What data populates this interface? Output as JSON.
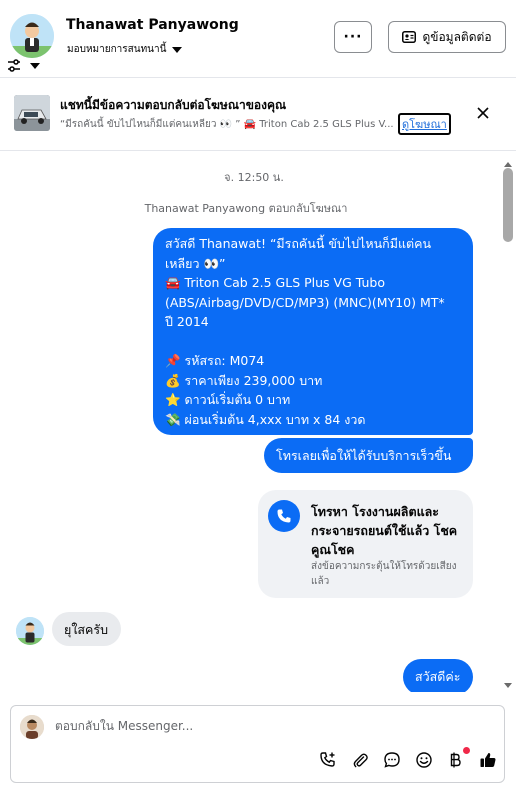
{
  "header": {
    "contact_name": "Thanawat Panyawong",
    "assign_label": "มอบหมายการสนทนานี้",
    "more_label": "···",
    "contact_info_label": "ดูข้อมูลติดต่อ"
  },
  "ad_banner": {
    "title": "แชทนี้มีข้อความตอบกลับต่อโฆษณาของคุณ",
    "subtitle": "“มีรถคันนี้ ขับไปไหนก็มีแต่คนเหลียว 👀 ” 🚘 Triton Cab 2.5 GLS Plus V...",
    "link_label": "ดูโฆษณา"
  },
  "chat": {
    "timestamp": "จ. 12:50 น.",
    "reply_note": "Thanawat Panyawong ตอบกลับโฆษณา",
    "messages": {
      "ad_message": {
        "line1": "สวัสดี Thanawat! “มีรถคันนี้ ขับไปไหนก็มีแต่คน",
        "line2": "เหลียว 👀”",
        "line3": "🚘 Triton Cab 2.5 GLS Plus VG Tubo",
        "line4": "(ABS/Airbag/DVD/CD/MP3) (MNC)(MY10) MT*",
        "line5": "ปี 2014",
        "line6": "📌 รหัสรถ: M074",
        "line7": "💰 ราคาเพียง 239,000 บาท",
        "line8": "⭐ ดาวน์เริ่มต้น 0 บาท",
        "line9": "💸 ผ่อนเริ่มต้น 4,xxx บาท x 84 งวด"
      },
      "call_prompt": "โทรเลยเพื่อให้ได้รับบริการเร็วขึ้น",
      "call_card": {
        "title": "โทรหา โรงงานผลิตและกระจายรถยนต์ใช้แล้ว โชคคูณโชค",
        "subtitle": "ส่งข้อความกระตุ้นให้โทรด้วยเสียงแล้ว"
      },
      "incoming": "ยุใสครับ",
      "outgoing_last": "สวัสดีค่ะ"
    }
  },
  "composer": {
    "placeholder": "ตอบกลับใน Messenger..."
  },
  "icons": {
    "filter": "sliders-icon",
    "more": "ellipsis-icon",
    "contact_card": "contact-card-icon",
    "close": "close-icon",
    "phone": "phone-icon",
    "call_add": "phone-plus-icon",
    "attach": "paperclip-icon",
    "saved_reply": "chat-bubble-icon",
    "emoji": "smiley-icon",
    "payment": "baht-icon",
    "like": "thumbs-up-icon"
  },
  "colors": {
    "outgoing_bubble": "#0b6cf5",
    "incoming_bubble": "#e9ebee",
    "link": "#216fdb",
    "notification_dot": "#f02849"
  }
}
